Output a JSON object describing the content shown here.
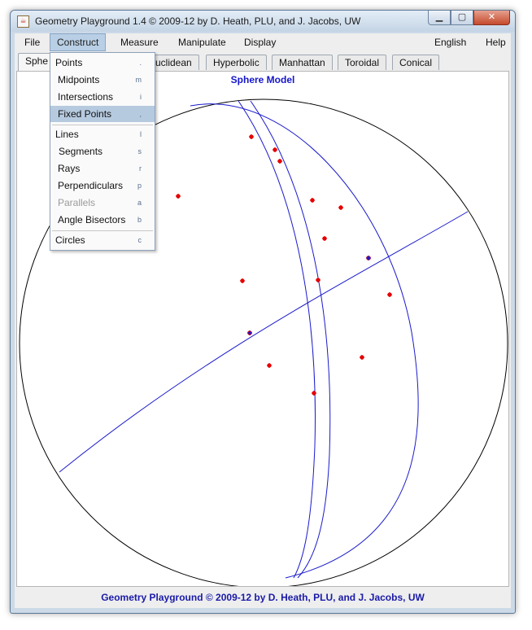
{
  "window": {
    "title": "Geometry Playground 1.4 © 2009-12 by D. Heath, PLU, and J. Jacobs, UW",
    "icon": "java-icon",
    "minimize_glyph": "▁",
    "maximize_glyph": "▢",
    "close_glyph": "✕"
  },
  "menubar": {
    "file": "File",
    "construct": "Construct",
    "measure": "Measure",
    "manipulate": "Manipulate",
    "display": "Display",
    "language": "English",
    "help": "Help"
  },
  "tabs": {
    "sphere": "Sphe",
    "euclidean": "Euclidean",
    "hyperbolic": "Hyperbolic",
    "manhattan": "Manhattan",
    "toroidal": "Toroidal",
    "conical": "Conical"
  },
  "construct_menu": {
    "points": {
      "label": "Points",
      "accel": "."
    },
    "midpoints": {
      "label": "Midpoints",
      "accel": "m"
    },
    "intersections": {
      "label": "Intersections",
      "accel": "i"
    },
    "fixed_points": {
      "label": "Fixed Points",
      "accel": ","
    },
    "lines": {
      "label": "Lines",
      "accel": "l"
    },
    "segments": {
      "label": "Segments",
      "accel": "s"
    },
    "rays": {
      "label": "Rays",
      "accel": "r"
    },
    "perpendiculars": {
      "label": "Perpendiculars",
      "accel": "p"
    },
    "parallels": {
      "label": "Parallels",
      "accel": "a"
    },
    "angle_bisectors": {
      "label": "Angle Bisectors",
      "accel": "b"
    },
    "circles": {
      "label": "Circles",
      "accel": "c"
    }
  },
  "canvas": {
    "model_title": "Sphere Model",
    "point_color": "#e60000",
    "curve_color": "#1a1acc",
    "boundary_color": "#000000"
  },
  "footer": {
    "text": "Geometry Playground © 2009-12 by D. Heath, PLU, and J. Jacobs, UW"
  }
}
